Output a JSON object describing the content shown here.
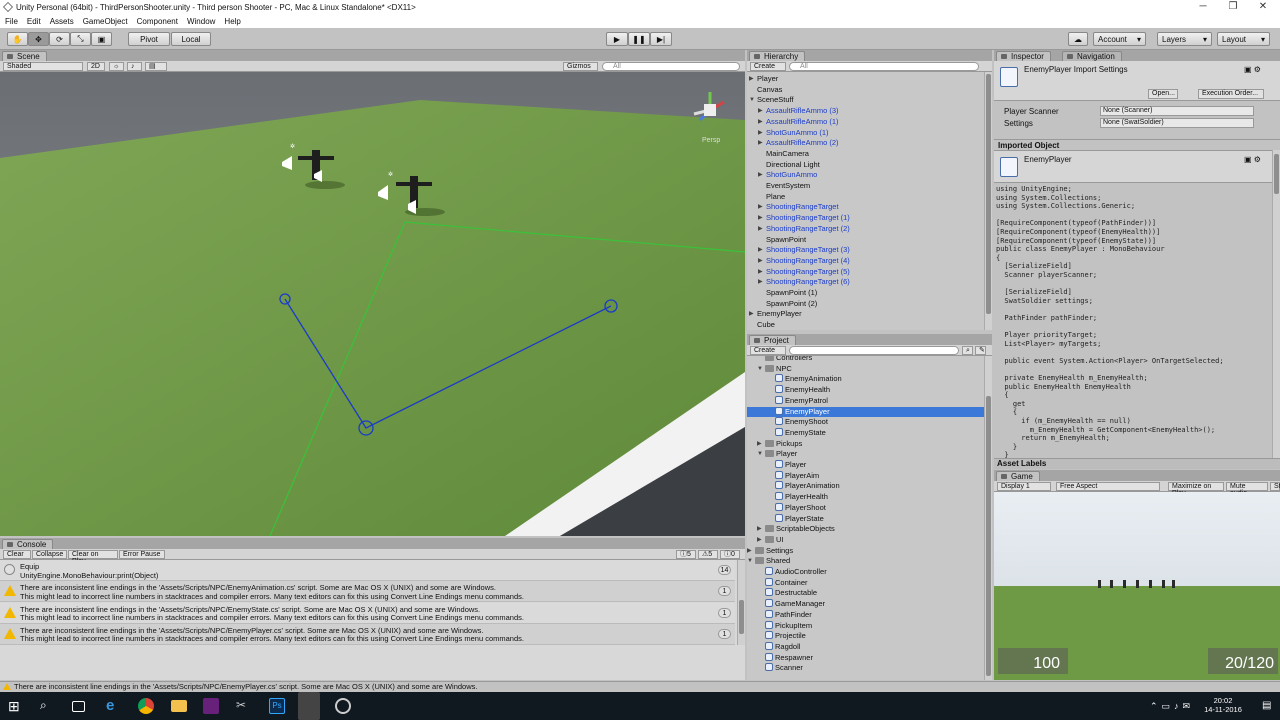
{
  "window": {
    "title": "Unity Personal (64bit) - ThirdPersonShooter.unity - Third person Shooter - PC, Mac & Linux Standalone* <DX11>",
    "controls": [
      "minimize-icon",
      "restore-icon",
      "close-icon"
    ]
  },
  "menu": [
    "File",
    "Edit",
    "Assets",
    "GameObject",
    "Component",
    "Window",
    "Help"
  ],
  "toolbar": {
    "tools": [
      "hand-icon",
      "move-icon",
      "rotate-icon",
      "scale-icon",
      "rect-icon"
    ],
    "pivot": "Pivot",
    "local": "Local",
    "play": [
      "play-icon",
      "pause-icon",
      "step-icon"
    ],
    "account": "Account",
    "layers": "Layers",
    "layout": "Layout"
  },
  "scene": {
    "tab": "Scene",
    "shading": "Shaded",
    "mode2d": "2D",
    "gizmos": "Gizmos",
    "search_placeholder": "All",
    "persp": "Persp"
  },
  "hierarchy": {
    "tab": "Hierarchy",
    "create": "Create",
    "search_placeholder": "All",
    "items": [
      {
        "label": "Player",
        "indent": 0,
        "arrow": "▶",
        "blue": false
      },
      {
        "label": "Canvas",
        "indent": 0,
        "arrow": "",
        "blue": false
      },
      {
        "label": "SceneStuff",
        "indent": 0,
        "arrow": "▼",
        "blue": false
      },
      {
        "label": "AssaultRifleAmmo (3)",
        "indent": 1,
        "arrow": "▶",
        "blue": true
      },
      {
        "label": "AssaultRifleAmmo (1)",
        "indent": 1,
        "arrow": "▶",
        "blue": true
      },
      {
        "label": "ShotGunAmmo (1)",
        "indent": 1,
        "arrow": "▶",
        "blue": true
      },
      {
        "label": "AssaultRifleAmmo (2)",
        "indent": 1,
        "arrow": "▶",
        "blue": true
      },
      {
        "label": "MainCamera",
        "indent": 1,
        "arrow": "",
        "blue": false
      },
      {
        "label": "Directional Light",
        "indent": 1,
        "arrow": "",
        "blue": false
      },
      {
        "label": "ShotGunAmmo",
        "indent": 1,
        "arrow": "▶",
        "blue": true
      },
      {
        "label": "EventSystem",
        "indent": 1,
        "arrow": "",
        "blue": false
      },
      {
        "label": "Plane",
        "indent": 1,
        "arrow": "",
        "blue": false
      },
      {
        "label": "ShootingRangeTarget",
        "indent": 1,
        "arrow": "▶",
        "blue": true
      },
      {
        "label": "ShootingRangeTarget (1)",
        "indent": 1,
        "arrow": "▶",
        "blue": true
      },
      {
        "label": "ShootingRangeTarget (2)",
        "indent": 1,
        "arrow": "▶",
        "blue": true
      },
      {
        "label": "SpawnPoint",
        "indent": 1,
        "arrow": "",
        "blue": false
      },
      {
        "label": "ShootingRangeTarget (3)",
        "indent": 1,
        "arrow": "▶",
        "blue": true
      },
      {
        "label": "ShootingRangeTarget (4)",
        "indent": 1,
        "arrow": "▶",
        "blue": true
      },
      {
        "label": "ShootingRangeTarget (5)",
        "indent": 1,
        "arrow": "▶",
        "blue": true
      },
      {
        "label": "ShootingRangeTarget (6)",
        "indent": 1,
        "arrow": "▶",
        "blue": true
      },
      {
        "label": "SpawnPoint (1)",
        "indent": 1,
        "arrow": "",
        "blue": false
      },
      {
        "label": "SpawnPoint (2)",
        "indent": 1,
        "arrow": "",
        "blue": false
      },
      {
        "label": "EnemyPlayer",
        "indent": 0,
        "arrow": "▶",
        "blue": false
      },
      {
        "label": "Cube",
        "indent": 0,
        "arrow": "",
        "blue": false
      }
    ]
  },
  "project": {
    "tab": "Project",
    "create": "Create",
    "items": [
      {
        "label": "Controllers",
        "indent": 1,
        "kind": "folder",
        "arrow": ""
      },
      {
        "label": "NPC",
        "indent": 1,
        "kind": "folder",
        "arrow": "▼"
      },
      {
        "label": "EnemyAnimation",
        "indent": 2,
        "kind": "script",
        "arrow": ""
      },
      {
        "label": "EnemyHealth",
        "indent": 2,
        "kind": "script",
        "arrow": ""
      },
      {
        "label": "EnemyPatrol",
        "indent": 2,
        "kind": "script",
        "arrow": ""
      },
      {
        "label": "EnemyPlayer",
        "indent": 2,
        "kind": "script",
        "arrow": "",
        "selected": true
      },
      {
        "label": "EnemyShoot",
        "indent": 2,
        "kind": "script",
        "arrow": ""
      },
      {
        "label": "EnemyState",
        "indent": 2,
        "kind": "script",
        "arrow": ""
      },
      {
        "label": "Pickups",
        "indent": 1,
        "kind": "folder",
        "arrow": "▶"
      },
      {
        "label": "Player",
        "indent": 1,
        "kind": "folder",
        "arrow": "▼"
      },
      {
        "label": "Player",
        "indent": 2,
        "kind": "script",
        "arrow": ""
      },
      {
        "label": "PlayerAim",
        "indent": 2,
        "kind": "script",
        "arrow": ""
      },
      {
        "label": "PlayerAnimation",
        "indent": 2,
        "kind": "script",
        "arrow": ""
      },
      {
        "label": "PlayerHealth",
        "indent": 2,
        "kind": "script",
        "arrow": ""
      },
      {
        "label": "PlayerShoot",
        "indent": 2,
        "kind": "script",
        "arrow": ""
      },
      {
        "label": "PlayerState",
        "indent": 2,
        "kind": "script",
        "arrow": ""
      },
      {
        "label": "ScriptableObjects",
        "indent": 1,
        "kind": "folder",
        "arrow": "▶"
      },
      {
        "label": "UI",
        "indent": 1,
        "kind": "folder",
        "arrow": "▶"
      },
      {
        "label": "Settings",
        "indent": 0,
        "kind": "folder",
        "arrow": "▶"
      },
      {
        "label": "Shared",
        "indent": 0,
        "kind": "folder",
        "arrow": "▼"
      },
      {
        "label": "AudioController",
        "indent": 1,
        "kind": "script",
        "arrow": ""
      },
      {
        "label": "Container",
        "indent": 1,
        "kind": "script",
        "arrow": ""
      },
      {
        "label": "Destructable",
        "indent": 1,
        "kind": "script",
        "arrow": ""
      },
      {
        "label": "GameManager",
        "indent": 1,
        "kind": "script",
        "arrow": ""
      },
      {
        "label": "PathFinder",
        "indent": 1,
        "kind": "script",
        "arrow": ""
      },
      {
        "label": "PickupItem",
        "indent": 1,
        "kind": "script",
        "arrow": ""
      },
      {
        "label": "Projectile",
        "indent": 1,
        "kind": "script",
        "arrow": ""
      },
      {
        "label": "Ragdoll",
        "indent": 1,
        "kind": "script",
        "arrow": ""
      },
      {
        "label": "Respawner",
        "indent": 1,
        "kind": "script",
        "arrow": ""
      },
      {
        "label": "Scanner",
        "indent": 1,
        "kind": "script",
        "arrow": ""
      }
    ]
  },
  "inspector": {
    "tab": "Inspector",
    "tab2": "Navigation",
    "title": "EnemyPlayer Import Settings",
    "open": "Open...",
    "exec_order": "Execution Order...",
    "fields": [
      {
        "label": "Player Scanner",
        "value": "None (Scanner)"
      },
      {
        "label": "Settings",
        "value": "None (SwatSoldier)"
      }
    ],
    "imported_header": "Imported Object",
    "imported_name": "EnemyPlayer",
    "code": "using UnityEngine;\nusing System.Collections;\nusing System.Collections.Generic;\n\n[RequireComponent(typeof(PathFinder))]\n[RequireComponent(typeof(EnemyHealth))]\n[RequireComponent(typeof(EnemyState))]\npublic class EnemyPlayer : MonoBehaviour\n{\n  [SerializeField]\n  Scanner playerScanner;\n\n  [SerializeField]\n  SwatSoldier settings;\n\n  PathFinder pathFinder;\n\n  Player priorityTarget;\n  List<Player> myTargets;\n\n  public event System.Action<Player> OnTargetSelected;\n\n  private EnemyHealth m_EnemyHealth;\n  public EnemyHealth EnemyHealth\n  {\n    get\n    {\n      if (m_EnemyHealth == null)\n        m_EnemyHealth = GetComponent<EnemyHealth>();\n      return m_EnemyHealth;\n    }\n  }",
    "asset_labels": "Asset Labels"
  },
  "game": {
    "tab": "Game",
    "display": "Display 1",
    "aspect": "Free Aspect",
    "maximize": "Maximize on Play",
    "mute": "Mute audio",
    "stats": "St",
    "health": "100",
    "ammo": "20/120"
  },
  "console": {
    "tab": "Console",
    "buttons": [
      "Clear",
      "Collapse",
      "Clear on Play",
      "Error Pause"
    ],
    "counts": [
      "5",
      "5",
      "0"
    ],
    "entries": [
      {
        "line1": "Equip",
        "line2": "UnityEngine.MonoBehaviour:print(Object)",
        "count": "14",
        "icon": "info"
      },
      {
        "line1": "There are inconsistent line endings in the 'Assets/Scripts/NPC/EnemyAnimation.cs' script. Some are Mac OS X (UNIX) and some are Windows.",
        "line2": "This might lead to incorrect line numbers in stacktraces and compiler errors. Many text editors can fix this using Convert Line Endings menu commands.",
        "count": "1",
        "icon": "warning"
      },
      {
        "line1": "There are inconsistent line endings in the 'Assets/Scripts/NPC/EnemyState.cs' script. Some are Mac OS X (UNIX) and some are Windows.",
        "line2": "This might lead to incorrect line numbers in stacktraces and compiler errors. Many text editors can fix this using Convert Line Endings menu commands.",
        "count": "1",
        "icon": "warning"
      },
      {
        "line1": "There are inconsistent line endings in the 'Assets/Scripts/NPC/EnemyPlayer.cs' script. Some are Mac OS X (UNIX) and some are Windows.",
        "line2": "This might lead to incorrect line numbers in stacktraces and compiler errors. Many text editors can fix this using Convert Line Endings menu commands.",
        "count": "1",
        "icon": "warning"
      }
    ]
  },
  "statusbar": "There are inconsistent line endings in the 'Assets/Scripts/NPC/EnemyPlayer.cs' script. Some are Mac OS X (UNIX) and some are Windows.",
  "taskbar": {
    "time": "20:02",
    "date": "14-11-2016",
    "apps": [
      "windows-start-icon",
      "search-icon",
      "task-view-icon",
      "edge-icon",
      "chrome-icon",
      "explorer-icon",
      "visual-studio-icon",
      "tools-icon",
      "photoshop-icon",
      "unity-icon",
      "misc-app-icon"
    ]
  },
  "colors": {
    "selection": "#3c78d8",
    "prefab_blue": "#1a3cc8",
    "ground": "#6f9a45",
    "warning": "#f2b700"
  }
}
